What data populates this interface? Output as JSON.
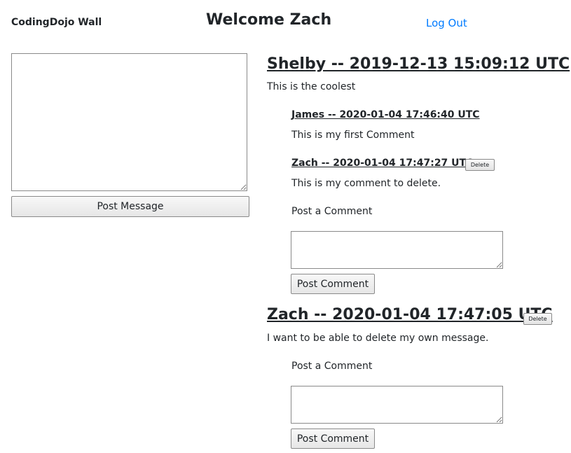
{
  "header": {
    "brand": "CodingDojo Wall",
    "welcome": "Welcome Zach",
    "logout_label": "Log Out"
  },
  "compose": {
    "message_value": "",
    "post_button_label": "Post Message"
  },
  "messages": [
    {
      "heading": "Shelby -- 2019-12-13 15:09:12 UTC",
      "text": "This is the coolest",
      "comments": [
        {
          "heading": "James -- 2020-01-04 17:46:40 UTC",
          "text": "This is my first Comment"
        },
        {
          "heading": "Zach -- 2020-01-04 17:47:27 UTC",
          "delete_label": "Delete",
          "text": "This is my comment to delete."
        }
      ],
      "comment_form": {
        "label": "Post a Comment",
        "value": "",
        "button_label": "Post Comment"
      }
    },
    {
      "heading": "Zach -- 2020-01-04 17:47:05 UTC",
      "delete_label": "Delete",
      "text": "I want to be able to delete my own message.",
      "comments": [],
      "comment_form": {
        "label": "Post a Comment",
        "value": "",
        "button_label": "Post Comment"
      }
    }
  ]
}
